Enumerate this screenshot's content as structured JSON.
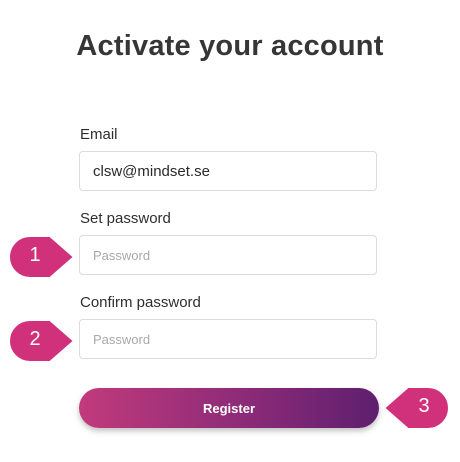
{
  "page": {
    "title": "Activate your account"
  },
  "form": {
    "email_label": "Email",
    "email_value": "clsw@mindset.se",
    "set_password_label": "Set password",
    "set_password_placeholder": "Password",
    "confirm_password_label": "Confirm password",
    "confirm_password_placeholder": "Password",
    "register_label": "Register"
  },
  "markers": {
    "one": "1",
    "two": "2",
    "three": "3"
  },
  "colors": {
    "marker": "#d0317a",
    "button_start": "#c13a7c",
    "button_end": "#5e1f6e"
  }
}
